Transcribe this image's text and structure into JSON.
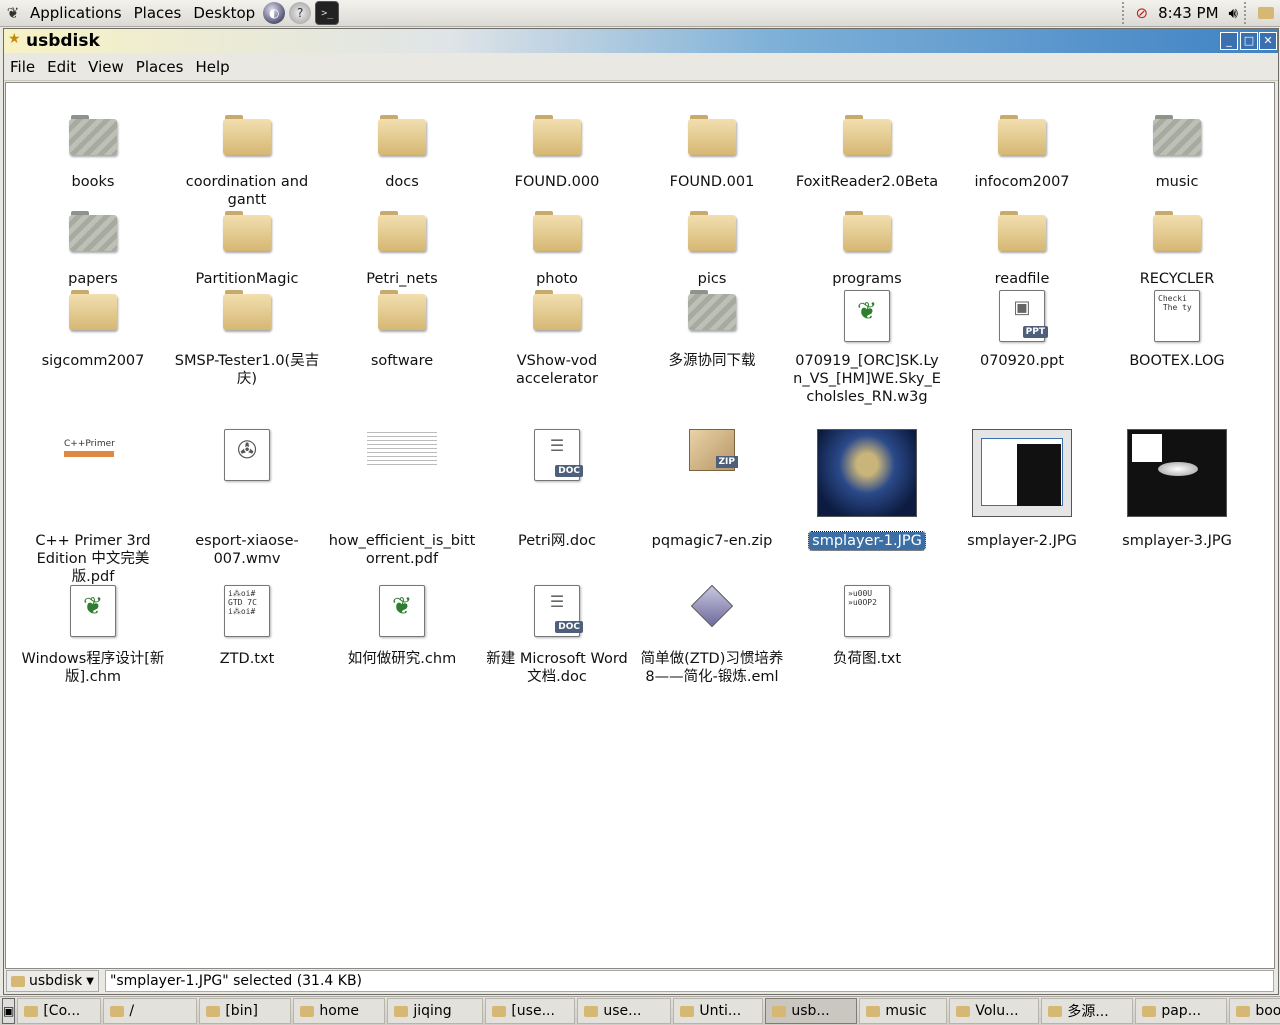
{
  "top_panel": {
    "menus": [
      "Applications",
      "Places",
      "Desktop"
    ],
    "clock": "8:43 PM"
  },
  "window": {
    "title": "usbdisk",
    "menubar": [
      {
        "label": "File"
      },
      {
        "label": "Edit"
      },
      {
        "label": "View"
      },
      {
        "label": "Places"
      },
      {
        "label": "Help"
      }
    ]
  },
  "files": [
    {
      "name": "books",
      "kind": "folder-grey"
    },
    {
      "name": "coordination and gantt",
      "kind": "folder"
    },
    {
      "name": "docs",
      "kind": "folder"
    },
    {
      "name": "FOUND.000",
      "kind": "folder"
    },
    {
      "name": "FOUND.001",
      "kind": "folder"
    },
    {
      "name": "FoxitReader2.0Beta",
      "kind": "folder"
    },
    {
      "name": "infocom2007",
      "kind": "folder"
    },
    {
      "name": "music",
      "kind": "folder-grey"
    },
    {
      "name": "papers",
      "kind": "folder-grey"
    },
    {
      "name": "PartitionMagic",
      "kind": "folder"
    },
    {
      "name": "Petri_nets",
      "kind": "folder"
    },
    {
      "name": "photo",
      "kind": "folder"
    },
    {
      "name": "pics",
      "kind": "folder"
    },
    {
      "name": "programs",
      "kind": "folder"
    },
    {
      "name": "readfile",
      "kind": "folder"
    },
    {
      "name": "RECYCLER",
      "kind": "folder"
    },
    {
      "name": "sigcomm2007",
      "kind": "folder"
    },
    {
      "name": "SMSP-Tester1.0(吴吉庆)",
      "kind": "folder"
    },
    {
      "name": "software",
      "kind": "folder"
    },
    {
      "name": "VShow-vod accelerator",
      "kind": "folder"
    },
    {
      "name": "多源协同下载",
      "kind": "folder-grey"
    },
    {
      "name": "070919_[ORC]SK.Lyn_VS_[HM]WE.Sky_Echolsles_RN.w3g",
      "kind": "gnome-file"
    },
    {
      "name": "070920.ppt",
      "kind": "ppt",
      "badge": "PPT"
    },
    {
      "name": "BOOTEX.LOG",
      "kind": "text",
      "preview": "Checki\n The ty"
    },
    {
      "name": "C++ Primer 3rd Edition 中文完美版.pdf",
      "kind": "pdf-cpp",
      "preview": "C++Primer"
    },
    {
      "name": "esport-xiaose-007.wmv",
      "kind": "video"
    },
    {
      "name": "how_efficient_is_bittorrent.pdf",
      "kind": "pdf"
    },
    {
      "name": "Petri网.doc",
      "kind": "doc",
      "badge": "DOC"
    },
    {
      "name": "pqmagic7-en.zip",
      "kind": "zip",
      "badge": "ZIP"
    },
    {
      "name": "smplayer-1.JPG",
      "kind": "photo-fox",
      "selected": true
    },
    {
      "name": "smplayer-2.JPG",
      "kind": "photo-win"
    },
    {
      "name": "smplayer-3.JPG",
      "kind": "photo-dark"
    },
    {
      "name": "Windows程序设计[新版].chm",
      "kind": "gnome-file"
    },
    {
      "name": "ZTD.txt",
      "kind": "text",
      "preview": "i⁂oi#\nGTD 7C\ni⁂oi#"
    },
    {
      "name": "如何做研究.chm",
      "kind": "gnome-file"
    },
    {
      "name": "新建 Microsoft Word 文档.doc",
      "kind": "doc",
      "badge": "DOC"
    },
    {
      "name": "简单做(ZTD)习惯培养8——简化-锻炼.eml",
      "kind": "eml"
    },
    {
      "name": "负荷图.txt",
      "kind": "text",
      "preview": "»u00U\n»u0OP2"
    }
  ],
  "statusbar": {
    "location": "usbdisk",
    "status": "\"smplayer-1.JPG\" selected (31.4 KB)"
  },
  "taskbar": [
    {
      "label": "[Co...",
      "active": false
    },
    {
      "label": "/",
      "active": false
    },
    {
      "label": "[bin]",
      "active": false
    },
    {
      "label": "home",
      "active": false
    },
    {
      "label": "jiqing",
      "active": false
    },
    {
      "label": "[use...",
      "active": false
    },
    {
      "label": "use...",
      "active": false
    },
    {
      "label": "Unti...",
      "active": false
    },
    {
      "label": "usb...",
      "active": true
    },
    {
      "label": "music",
      "active": false
    },
    {
      "label": "Volu...",
      "active": false
    },
    {
      "label": "多源...",
      "active": false
    },
    {
      "label": "pap...",
      "active": false
    },
    {
      "label": "books",
      "active": false
    }
  ]
}
